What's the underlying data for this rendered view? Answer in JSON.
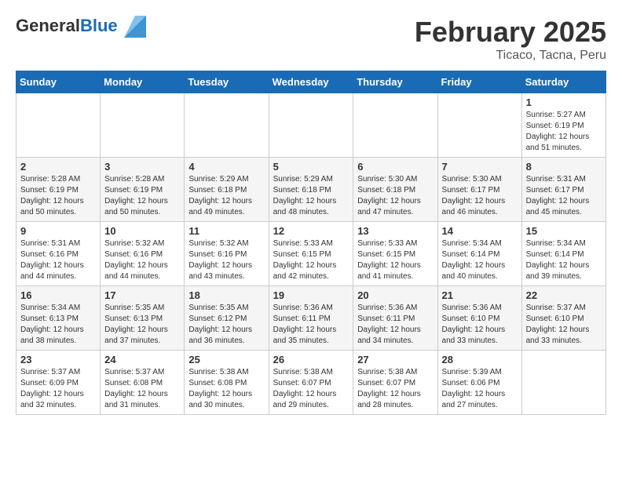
{
  "header": {
    "logo_general": "General",
    "logo_blue": "Blue",
    "month_title": "February 2025",
    "location": "Ticaco, Tacna, Peru"
  },
  "calendar": {
    "days_of_week": [
      "Sunday",
      "Monday",
      "Tuesday",
      "Wednesday",
      "Thursday",
      "Friday",
      "Saturday"
    ],
    "weeks": [
      [
        {
          "day": "",
          "info": ""
        },
        {
          "day": "",
          "info": ""
        },
        {
          "day": "",
          "info": ""
        },
        {
          "day": "",
          "info": ""
        },
        {
          "day": "",
          "info": ""
        },
        {
          "day": "",
          "info": ""
        },
        {
          "day": "1",
          "info": "Sunrise: 5:27 AM\nSunset: 6:19 PM\nDaylight: 12 hours\nand 51 minutes."
        }
      ],
      [
        {
          "day": "2",
          "info": "Sunrise: 5:28 AM\nSunset: 6:19 PM\nDaylight: 12 hours\nand 50 minutes."
        },
        {
          "day": "3",
          "info": "Sunrise: 5:28 AM\nSunset: 6:19 PM\nDaylight: 12 hours\nand 50 minutes."
        },
        {
          "day": "4",
          "info": "Sunrise: 5:29 AM\nSunset: 6:18 PM\nDaylight: 12 hours\nand 49 minutes."
        },
        {
          "day": "5",
          "info": "Sunrise: 5:29 AM\nSunset: 6:18 PM\nDaylight: 12 hours\nand 48 minutes."
        },
        {
          "day": "6",
          "info": "Sunrise: 5:30 AM\nSunset: 6:18 PM\nDaylight: 12 hours\nand 47 minutes."
        },
        {
          "day": "7",
          "info": "Sunrise: 5:30 AM\nSunset: 6:17 PM\nDaylight: 12 hours\nand 46 minutes."
        },
        {
          "day": "8",
          "info": "Sunrise: 5:31 AM\nSunset: 6:17 PM\nDaylight: 12 hours\nand 45 minutes."
        }
      ],
      [
        {
          "day": "9",
          "info": "Sunrise: 5:31 AM\nSunset: 6:16 PM\nDaylight: 12 hours\nand 44 minutes."
        },
        {
          "day": "10",
          "info": "Sunrise: 5:32 AM\nSunset: 6:16 PM\nDaylight: 12 hours\nand 44 minutes."
        },
        {
          "day": "11",
          "info": "Sunrise: 5:32 AM\nSunset: 6:16 PM\nDaylight: 12 hours\nand 43 minutes."
        },
        {
          "day": "12",
          "info": "Sunrise: 5:33 AM\nSunset: 6:15 PM\nDaylight: 12 hours\nand 42 minutes."
        },
        {
          "day": "13",
          "info": "Sunrise: 5:33 AM\nSunset: 6:15 PM\nDaylight: 12 hours\nand 41 minutes."
        },
        {
          "day": "14",
          "info": "Sunrise: 5:34 AM\nSunset: 6:14 PM\nDaylight: 12 hours\nand 40 minutes."
        },
        {
          "day": "15",
          "info": "Sunrise: 5:34 AM\nSunset: 6:14 PM\nDaylight: 12 hours\nand 39 minutes."
        }
      ],
      [
        {
          "day": "16",
          "info": "Sunrise: 5:34 AM\nSunset: 6:13 PM\nDaylight: 12 hours\nand 38 minutes."
        },
        {
          "day": "17",
          "info": "Sunrise: 5:35 AM\nSunset: 6:13 PM\nDaylight: 12 hours\nand 37 minutes."
        },
        {
          "day": "18",
          "info": "Sunrise: 5:35 AM\nSunset: 6:12 PM\nDaylight: 12 hours\nand 36 minutes."
        },
        {
          "day": "19",
          "info": "Sunrise: 5:36 AM\nSunset: 6:11 PM\nDaylight: 12 hours\nand 35 minutes."
        },
        {
          "day": "20",
          "info": "Sunrise: 5:36 AM\nSunset: 6:11 PM\nDaylight: 12 hours\nand 34 minutes."
        },
        {
          "day": "21",
          "info": "Sunrise: 5:36 AM\nSunset: 6:10 PM\nDaylight: 12 hours\nand 33 minutes."
        },
        {
          "day": "22",
          "info": "Sunrise: 5:37 AM\nSunset: 6:10 PM\nDaylight: 12 hours\nand 33 minutes."
        }
      ],
      [
        {
          "day": "23",
          "info": "Sunrise: 5:37 AM\nSunset: 6:09 PM\nDaylight: 12 hours\nand 32 minutes."
        },
        {
          "day": "24",
          "info": "Sunrise: 5:37 AM\nSunset: 6:08 PM\nDaylight: 12 hours\nand 31 minutes."
        },
        {
          "day": "25",
          "info": "Sunrise: 5:38 AM\nSunset: 6:08 PM\nDaylight: 12 hours\nand 30 minutes."
        },
        {
          "day": "26",
          "info": "Sunrise: 5:38 AM\nSunset: 6:07 PM\nDaylight: 12 hours\nand 29 minutes."
        },
        {
          "day": "27",
          "info": "Sunrise: 5:38 AM\nSunset: 6:07 PM\nDaylight: 12 hours\nand 28 minutes."
        },
        {
          "day": "28",
          "info": "Sunrise: 5:39 AM\nSunset: 6:06 PM\nDaylight: 12 hours\nand 27 minutes."
        },
        {
          "day": "",
          "info": ""
        }
      ]
    ]
  }
}
